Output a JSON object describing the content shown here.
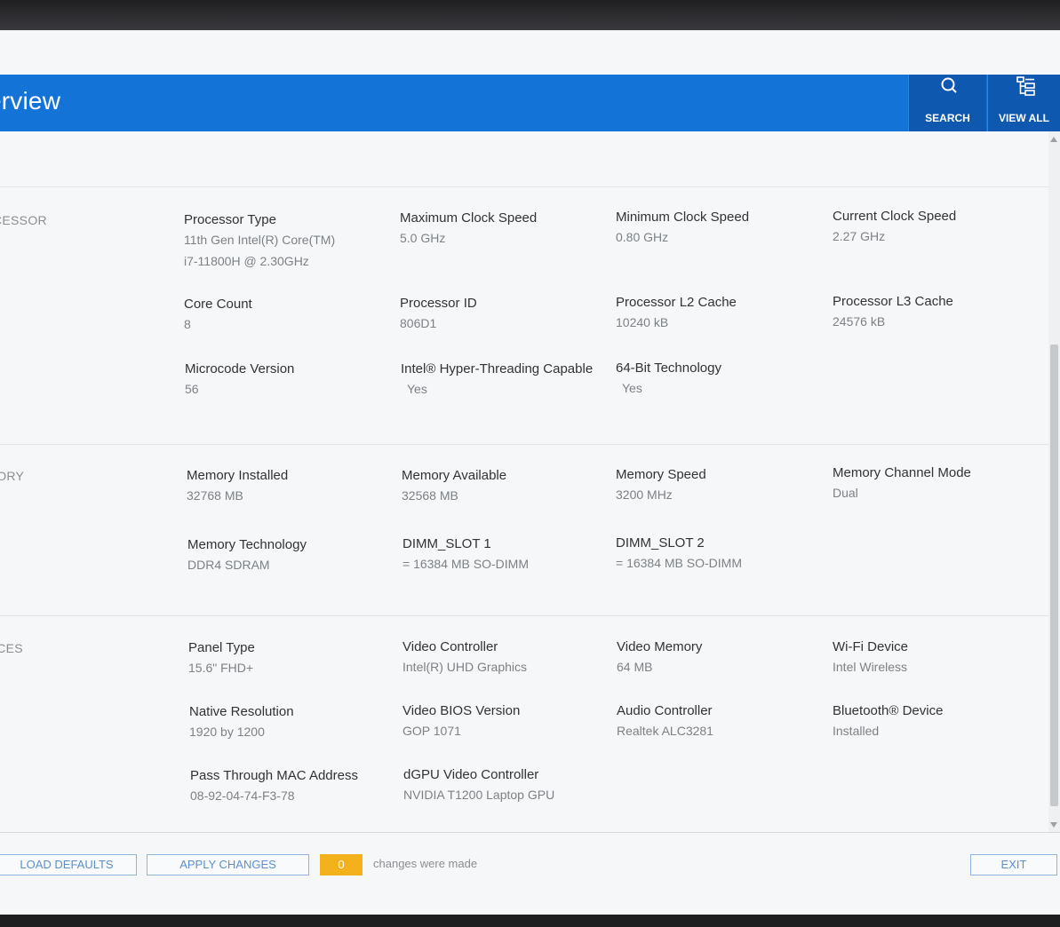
{
  "header": {
    "title": "erview",
    "search_label": "SEARCH",
    "view_all_label": "VIEW ALL"
  },
  "sections": {
    "processor": {
      "label": "CESSOR",
      "fields": [
        {
          "name": "Processor Type",
          "value_line1": "11th Gen Intel(R) Core(TM)",
          "value_line2": "i7-11800H @ 2.30GHz"
        },
        {
          "name": "Maximum Clock Speed",
          "value": "5.0 GHz"
        },
        {
          "name": "Minimum Clock Speed",
          "value": "0.80 GHz"
        },
        {
          "name": "Current Clock Speed",
          "value": "2.27 GHz"
        },
        {
          "name": "Core Count",
          "value": "8"
        },
        {
          "name": "Processor ID",
          "value": "806D1"
        },
        {
          "name": "Processor L2 Cache",
          "value": "10240 kB"
        },
        {
          "name": "Processor L3 Cache",
          "value": "24576 kB"
        },
        {
          "name": "Microcode Version",
          "value": "56"
        },
        {
          "name": "Intel® Hyper-Threading Capable",
          "value": "Yes"
        },
        {
          "name": "64-Bit Technology",
          "value": "Yes"
        }
      ]
    },
    "memory": {
      "label": "IORY",
      "fields": [
        {
          "name": "Memory Installed",
          "value": "32768 MB"
        },
        {
          "name": "Memory Available",
          "value": "32568 MB"
        },
        {
          "name": "Memory Speed",
          "value": "3200 MHz"
        },
        {
          "name": "Memory Channel Mode",
          "value": "Dual"
        },
        {
          "name": "Memory Technology",
          "value": "DDR4 SDRAM"
        },
        {
          "name": "DIMM_SLOT 1",
          "value": "= 16384 MB SO-DIMM"
        },
        {
          "name": "DIMM_SLOT 2",
          "value": "= 16384 MB SO-DIMM"
        }
      ]
    },
    "devices": {
      "label": "ICES",
      "fields": [
        {
          "name": "Panel Type",
          "value": "15.6\" FHD+"
        },
        {
          "name": "Video Controller",
          "value": "Intel(R) UHD Graphics"
        },
        {
          "name": "Video Memory",
          "value": "64 MB"
        },
        {
          "name": "Wi-Fi Device",
          "value": "Intel Wireless"
        },
        {
          "name": "Native Resolution",
          "value": "1920 by 1200"
        },
        {
          "name": "Video BIOS Version",
          "value": "GOP 1071"
        },
        {
          "name": "Audio Controller",
          "value": "Realtek ALC3281"
        },
        {
          "name": "Bluetooth® Device",
          "value": "Installed"
        },
        {
          "name": "Pass Through MAC Address",
          "value": "08-92-04-74-F3-78"
        },
        {
          "name": "dGPU Video Controller",
          "value": "NVIDIA T1200 Laptop GPU"
        }
      ]
    }
  },
  "footer": {
    "load_defaults_label": "LOAD DEFAULTS",
    "apply_changes_label": "APPLY CHANGES",
    "changes_count": "0",
    "changes_text": "changes were made",
    "exit_label": "EXIT"
  }
}
